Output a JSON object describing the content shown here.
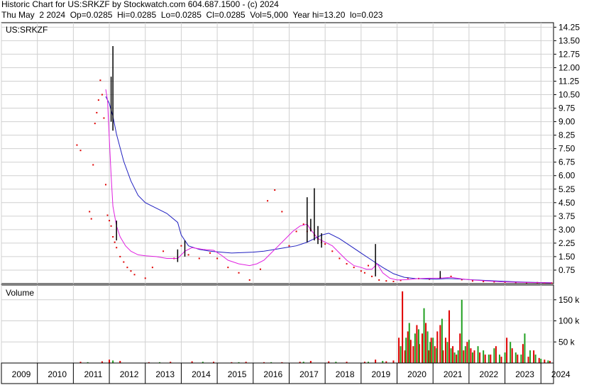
{
  "header": {
    "line1": "Historic Chart for US:SRKZF by Stockwatch.com 604.687.1500 - (c) 2024",
    "line2": "Thu May  2 2024  Op=0.0285  Hi=0.0285  Lo=0.0285  Cl=0.0285  Vol=5,000  Year hi=13.20  lo=0.023"
  },
  "chart_data": [
    {
      "type": "line",
      "title": "US:SRKZF",
      "x_type": "year",
      "xlim": [
        2009,
        2024.35
      ],
      "ylim": [
        0,
        14.5
      ],
      "y_ticks": [
        0.75,
        1.5,
        2.25,
        3.0,
        3.75,
        4.5,
        5.25,
        6.0,
        6.75,
        7.5,
        8.25,
        9.0,
        9.75,
        10.5,
        11.25,
        12.0,
        12.75,
        13.5,
        14.25
      ],
      "y_tick_labels": [
        "0.75",
        "1.50",
        "2.25",
        "3.00",
        "3.75",
        "4.50",
        "5.25",
        "6.00",
        "6.75",
        "7.50",
        "8.25",
        "9.00",
        "9.75",
        "10.50",
        "11.25",
        "12.00",
        "12.75",
        "13.50",
        "14.25"
      ],
      "grid": true,
      "series": [
        {
          "kind": "price",
          "color": "#e00000",
          "x": [
            2011.1,
            2011.2,
            2011.45,
            2011.5,
            2011.55,
            2011.6,
            2011.65,
            2011.7,
            2011.75,
            2011.8,
            2011.85,
            2011.9,
            2011.95,
            2012.0,
            2012.05,
            2012.1,
            2012.15,
            2012.2,
            2012.3,
            2012.4,
            2012.5,
            2012.6,
            2012.7,
            2013.0,
            2013.2,
            2013.5,
            2013.8,
            2014.0,
            2014.2,
            2014.5,
            2014.8,
            2015.0,
            2015.3,
            2015.6,
            2015.9,
            2016.2,
            2016.4,
            2016.6,
            2016.8,
            2017.0,
            2017.2,
            2017.4,
            2017.5,
            2017.6,
            2017.7,
            2017.8,
            2017.9,
            2018.0,
            2018.2,
            2018.4,
            2018.6,
            2018.8,
            2019.0,
            2019.1,
            2019.2,
            2019.3,
            2019.5,
            2019.7,
            2019.9,
            2020.1,
            2020.3,
            2020.6,
            2020.9,
            2021.2,
            2021.5,
            2021.8,
            2022.1,
            2022.4,
            2022.7,
            2023.0,
            2023.3,
            2023.6,
            2023.9,
            2024.1,
            2024.3
          ],
          "y": [
            7.7,
            7.4,
            4.0,
            3.6,
            6.6,
            8.9,
            9.5,
            10.2,
            11.3,
            10.5,
            9.2,
            5.5,
            3.8,
            3.5,
            3.2,
            2.6,
            2.3,
            2.0,
            1.5,
            1.2,
            0.9,
            0.7,
            0.5,
            0.3,
            0.9,
            1.8,
            1.4,
            2.1,
            1.6,
            1.4,
            1.7,
            1.4,
            0.9,
            0.6,
            0.2,
            0.8,
            4.6,
            5.2,
            4.0,
            2.1,
            2.9,
            3.3,
            2.9,
            3.0,
            2.7,
            2.5,
            2.3,
            2.2,
            1.8,
            1.4,
            1.1,
            0.9,
            0.7,
            0.6,
            1.0,
            0.4,
            0.2,
            0.15,
            0.12,
            0.18,
            0.3,
            0.28,
            0.25,
            0.32,
            0.4,
            0.22,
            0.15,
            0.12,
            0.1,
            0.08,
            0.07,
            0.06,
            0.05,
            0.04,
            0.03
          ]
        },
        {
          "kind": "moving-average-long",
          "color": "#2020c0",
          "x": [
            2011.9,
            2012.0,
            2012.1,
            2012.2,
            2012.4,
            2012.6,
            2012.8,
            2013.0,
            2013.3,
            2013.6,
            2013.9,
            2014.0,
            2014.2,
            2014.5,
            2014.8,
            2015.1,
            2015.4,
            2015.7,
            2016.0,
            2016.3,
            2016.6,
            2016.9,
            2017.2,
            2017.5,
            2017.7,
            2017.9,
            2018.1,
            2018.4,
            2018.7,
            2019.0,
            2019.3,
            2019.6,
            2019.9,
            2020.2,
            2020.5,
            2020.8,
            2021.1,
            2021.4,
            2021.7,
            2022.0,
            2022.4,
            2022.8,
            2023.2,
            2023.6,
            2024.0,
            2024.3
          ],
          "y": [
            10.4,
            10.0,
            9.3,
            8.3,
            6.8,
            5.7,
            4.9,
            4.5,
            4.2,
            3.9,
            3.4,
            2.7,
            2.1,
            1.9,
            1.8,
            1.75,
            1.7,
            1.72,
            1.75,
            1.8,
            1.9,
            2.0,
            2.1,
            2.3,
            2.5,
            2.7,
            2.8,
            2.5,
            2.1,
            1.7,
            1.3,
            0.9,
            0.55,
            0.35,
            0.28,
            0.26,
            0.25,
            0.28,
            0.26,
            0.22,
            0.18,
            0.14,
            0.11,
            0.08,
            0.06,
            0.05
          ]
        },
        {
          "kind": "moving-average-short",
          "color": "#e020e0",
          "x": [
            2011.9,
            2011.95,
            2012.0,
            2012.05,
            2012.1,
            2012.2,
            2012.3,
            2012.45,
            2012.6,
            2012.8,
            2013.0,
            2013.3,
            2013.6,
            2013.9,
            2014.1,
            2014.3,
            2014.6,
            2014.9,
            2015.1,
            2015.3,
            2015.6,
            2015.9,
            2016.1,
            2016.3,
            2016.6,
            2016.9,
            2017.1,
            2017.3,
            2017.5,
            2017.6,
            2017.8,
            2018.0,
            2018.2,
            2018.4,
            2018.6,
            2018.8,
            2019.0,
            2019.15,
            2019.3,
            2019.45,
            2019.6,
            2019.8,
            2020.0,
            2020.3,
            2020.6,
            2020.9,
            2021.2,
            2021.5,
            2021.8,
            2022.1,
            2022.5,
            2022.9,
            2023.3,
            2023.7,
            2024.0,
            2024.3
          ],
          "y": [
            10.8,
            10.2,
            8.0,
            6.0,
            4.3,
            3.2,
            2.6,
            2.1,
            1.8,
            1.6,
            1.55,
            1.5,
            1.4,
            1.4,
            1.8,
            2.0,
            1.9,
            1.85,
            1.6,
            1.3,
            1.1,
            1.0,
            1.1,
            1.3,
            1.9,
            2.5,
            2.9,
            3.2,
            3.3,
            3.0,
            2.5,
            2.3,
            2.1,
            1.7,
            1.3,
            1.0,
            0.9,
            0.8,
            0.8,
            1.1,
            0.6,
            0.3,
            0.2,
            0.22,
            0.28,
            0.3,
            0.3,
            0.35,
            0.26,
            0.2,
            0.15,
            0.1,
            0.08,
            0.06,
            0.05,
            0.04
          ]
        },
        {
          "kind": "high-low-bars",
          "color": "#000000",
          "x": [
            2012.05,
            2012.1,
            2012.2,
            2013.9,
            2014.1,
            2017.5,
            2017.6,
            2017.7,
            2017.8,
            2017.9,
            2019.4,
            2021.2
          ],
          "low": [
            9.0,
            8.5,
            2.4,
            1.2,
            1.5,
            2.3,
            2.9,
            2.4,
            2.2,
            2.0,
            0.4,
            0.3
          ],
          "high": [
            11.5,
            13.2,
            3.5,
            1.9,
            2.4,
            4.8,
            3.6,
            5.3,
            3.2,
            2.8,
            2.2,
            0.7
          ]
        }
      ]
    },
    {
      "type": "bar",
      "title": "Volume",
      "x_type": "year",
      "xlim": [
        2009,
        2024.35
      ],
      "ylim": [
        0,
        185000
      ],
      "y_ticks": [
        50000,
        100000,
        150000
      ],
      "y_tick_labels": [
        "50 k",
        "100 k",
        "150 k"
      ],
      "x_tick_labels": [
        "2009",
        "2010",
        "2011",
        "2012",
        "2013",
        "2014",
        "2015",
        "2016",
        "2017",
        "2018",
        "2019",
        "2020",
        "2021",
        "2022",
        "2023",
        "2024"
      ],
      "grid": true,
      "series": [
        {
          "name": "",
          "color": "#e00000",
          "x": [
            2011.2,
            2011.8,
            2012.0,
            2012.3,
            2013.1,
            2013.7,
            2014.3,
            2014.9,
            2015.4,
            2015.8,
            2016.3,
            2016.8,
            2017.3,
            2017.6,
            2018.1,
            2018.6,
            2019.1,
            2019.4,
            2019.7,
            2019.9,
            2020.05,
            2020.15,
            2020.22,
            2020.3,
            2020.38,
            2020.45,
            2020.55,
            2020.62,
            2020.7,
            2020.8,
            2020.88,
            2020.95,
            2021.05,
            2021.12,
            2021.2,
            2021.28,
            2021.35,
            2021.45,
            2021.55,
            2021.65,
            2021.75,
            2021.85,
            2021.95,
            2022.05,
            2022.15,
            2022.3,
            2022.45,
            2022.6,
            2022.75,
            2022.9,
            2023.05,
            2023.2,
            2023.35,
            2023.5,
            2023.65,
            2023.8,
            2023.95,
            2024.1,
            2024.25
          ],
          "values": [
            3000,
            4000,
            8000,
            5000,
            2000,
            3000,
            4000,
            3000,
            2000,
            3000,
            2000,
            2000,
            3000,
            5000,
            4000,
            3000,
            3000,
            8000,
            4000,
            6000,
            60000,
            170000,
            30000,
            75000,
            55000,
            40000,
            90000,
            45000,
            70000,
            95000,
            30000,
            60000,
            40000,
            75000,
            90000,
            30000,
            60000,
            125000,
            40000,
            20000,
            70000,
            30000,
            50000,
            35000,
            30000,
            25000,
            20000,
            20000,
            40000,
            15000,
            60000,
            35000,
            20000,
            45000,
            15000,
            30000,
            12000,
            8000,
            5000
          ]
        },
        {
          "name": "",
          "color": "#20a020",
          "x": [
            2011.4,
            2012.1,
            2013.4,
            2014.6,
            2015.6,
            2016.5,
            2017.4,
            2018.3,
            2019.2,
            2019.6,
            2020.1,
            2020.25,
            2020.34,
            2020.5,
            2020.6,
            2020.75,
            2020.85,
            2020.92,
            2021.0,
            2021.1,
            2021.25,
            2021.4,
            2021.5,
            2021.6,
            2021.7,
            2021.8,
            2021.9,
            2022.0,
            2022.1,
            2022.25,
            2022.4,
            2022.55,
            2022.7,
            2022.85,
            2023.0,
            2023.15,
            2023.3,
            2023.45,
            2023.55,
            2023.7,
            2023.85,
            2024.0,
            2024.2
          ],
          "values": [
            2000,
            6000,
            2000,
            3000,
            2000,
            2000,
            3000,
            3000,
            3000,
            5000,
            40000,
            60000,
            95000,
            70000,
            80000,
            130000,
            75000,
            50000,
            60000,
            35000,
            105000,
            50000,
            35000,
            25000,
            30000,
            150000,
            40000,
            55000,
            25000,
            40000,
            30000,
            20000,
            35000,
            20000,
            25000,
            50000,
            25000,
            20000,
            70000,
            30000,
            20000,
            10000,
            6000
          ]
        }
      ]
    }
  ]
}
